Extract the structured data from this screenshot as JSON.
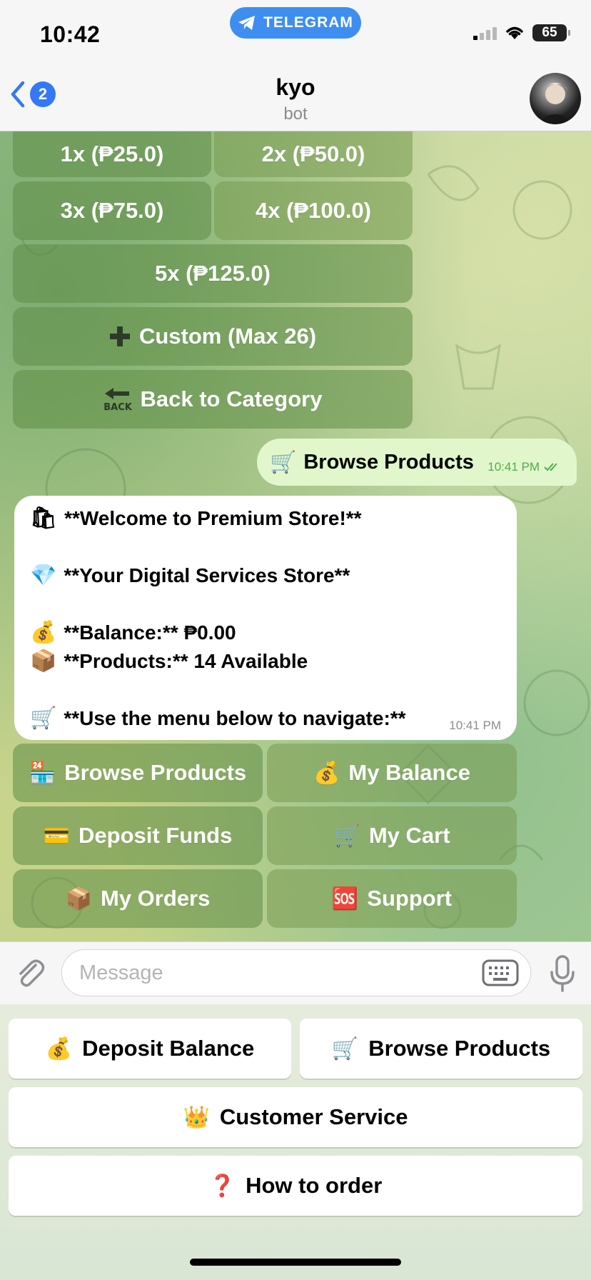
{
  "status_bar": {
    "time": "10:42",
    "app_pill": "TELEGRAM",
    "battery": "65"
  },
  "header": {
    "back_count": "2",
    "title": "kyo",
    "subtitle": "bot"
  },
  "quantity_buttons": [
    {
      "label": "1x (₱25.0)"
    },
    {
      "label": "2x (₱50.0)"
    },
    {
      "label": "3x (₱75.0)"
    },
    {
      "label": "4x (₱100.0)"
    },
    {
      "label": "5x (₱125.0)"
    }
  ],
  "custom_button": {
    "icon": "➕",
    "label": "Custom (Max 26)"
  },
  "back_button": {
    "icon": "🔙",
    "label": "Back to Category"
  },
  "outgoing": {
    "icon": "🛒",
    "text": "Browse Products",
    "time": "10:41 PM"
  },
  "incoming": {
    "lines": [
      {
        "icon": "🛍",
        "text": "**Welcome to Premium Store!**"
      },
      {
        "icon": "💎",
        "text": "**Your Digital Services Store**"
      },
      {
        "icon": "💰",
        "text": "**Balance:** ₱0.00"
      },
      {
        "icon": "📦",
        "text": "**Products:** 14 Available"
      },
      {
        "icon": "🛒",
        "text": "**Use the menu below to navigate:**"
      }
    ],
    "time": "10:41 PM"
  },
  "menu_buttons": [
    {
      "icon": "🏪",
      "label": "Browse Products"
    },
    {
      "icon": "💰",
      "label": "My Balance"
    },
    {
      "icon": "💳",
      "label": "Deposit Funds"
    },
    {
      "icon": "🛒",
      "label": "My Cart"
    },
    {
      "icon": "📦",
      "label": "My Orders"
    },
    {
      "icon": "🆘",
      "label": "Support"
    }
  ],
  "input": {
    "placeholder": "Message"
  },
  "reply_keyboard": [
    {
      "icon": "💰",
      "label": "Deposit Balance"
    },
    {
      "icon": "🛒",
      "label": "Browse Products"
    },
    {
      "icon": "👑",
      "label": "Customer Service"
    },
    {
      "icon": "❓",
      "label": "How to order"
    }
  ],
  "colors": {
    "accent": "#3478f6",
    "telegram_pill": "#3d8ef0",
    "outgoing_bubble": "#e1f7cb",
    "check": "#4fae4e"
  }
}
